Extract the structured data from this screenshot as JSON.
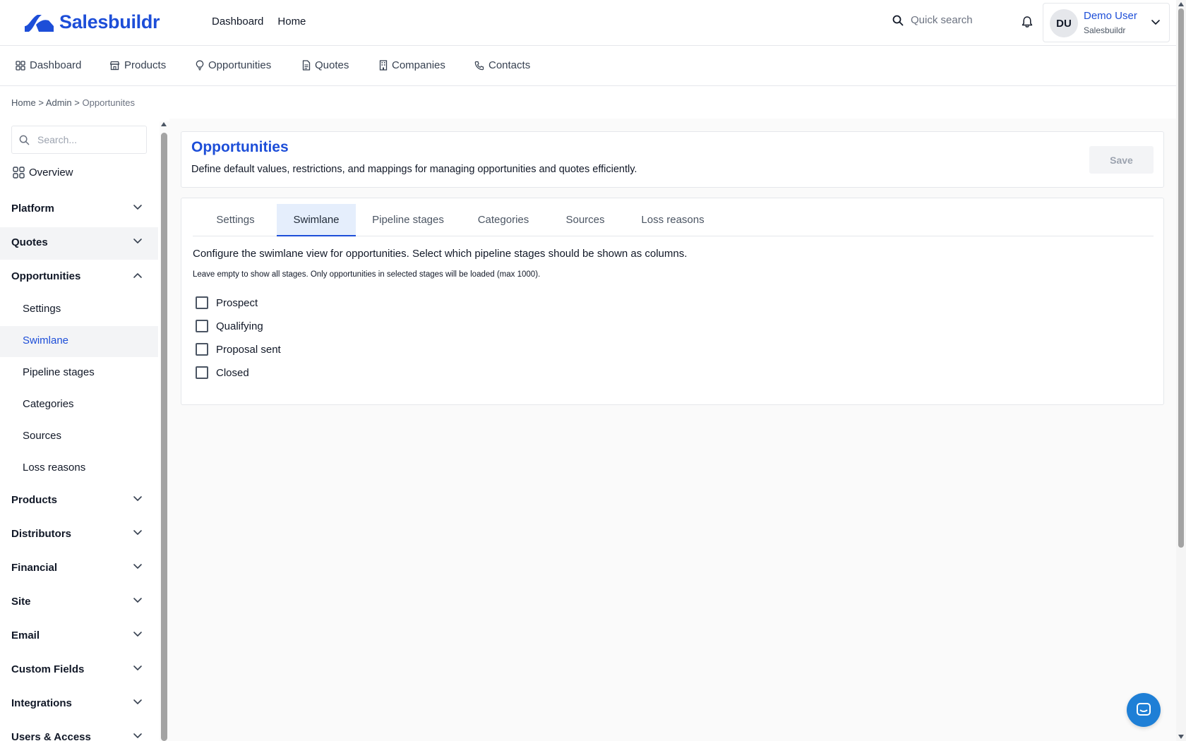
{
  "app": {
    "brand": "Salesbuildr",
    "top_nav": [
      "Dashboard",
      "Home"
    ],
    "quick_search_placeholder": "Quick search",
    "user": {
      "initials": "DU",
      "name": "Demo User",
      "org": "Salesbuildr"
    }
  },
  "main_nav": [
    {
      "label": "Dashboard",
      "icon": "grid-icon"
    },
    {
      "label": "Products",
      "icon": "store-icon"
    },
    {
      "label": "Opportunities",
      "icon": "lightbulb-icon"
    },
    {
      "label": "Quotes",
      "icon": "document-icon"
    },
    {
      "label": "Companies",
      "icon": "building-icon"
    },
    {
      "label": "Contacts",
      "icon": "phone-icon"
    }
  ],
  "breadcrumb": {
    "home": "Home",
    "sep1": ">",
    "admin": "Admin",
    "sep2": ">",
    "current": "Opportunites"
  },
  "sidebar": {
    "search_placeholder": "Search...",
    "overview": "Overview",
    "sections": {
      "platform": "Platform",
      "quotes": "Quotes",
      "opportunities": "Opportunities",
      "products": "Products",
      "distributors": "Distributors",
      "financial": "Financial",
      "site": "Site",
      "email": "Email",
      "custom_fields": "Custom Fields",
      "integrations": "Integrations",
      "users_access": "Users & Access"
    },
    "opportunities_children": [
      "Settings",
      "Swimlane",
      "Pipeline stages",
      "Categories",
      "Sources",
      "Loss reasons"
    ],
    "selected": "Swimlane"
  },
  "page": {
    "title": "Opportunities",
    "description": "Define default values, restrictions, and mappings for managing opportunities and quotes efficiently.",
    "save_label": "Save",
    "tabs": [
      "Settings",
      "Swimlane",
      "Pipeline stages",
      "Categories",
      "Sources",
      "Loss reasons"
    ],
    "active_tab": "Swimlane",
    "intro": "Configure the swimlane view for opportunities. Select which pipeline stages should be shown as columns.",
    "hint": "Leave empty to show all stages. Only opportunities in selected stages will be loaded (max 1000).",
    "stages": [
      {
        "label": "Prospect",
        "checked": false
      },
      {
        "label": "Qualifying",
        "checked": false
      },
      {
        "label": "Proposal sent",
        "checked": false
      },
      {
        "label": "Closed",
        "checked": false
      }
    ]
  },
  "colors": {
    "brand": "#1d4ed8",
    "active_tab_bg": "#e5eefc",
    "chat": "#1e7fd6"
  }
}
